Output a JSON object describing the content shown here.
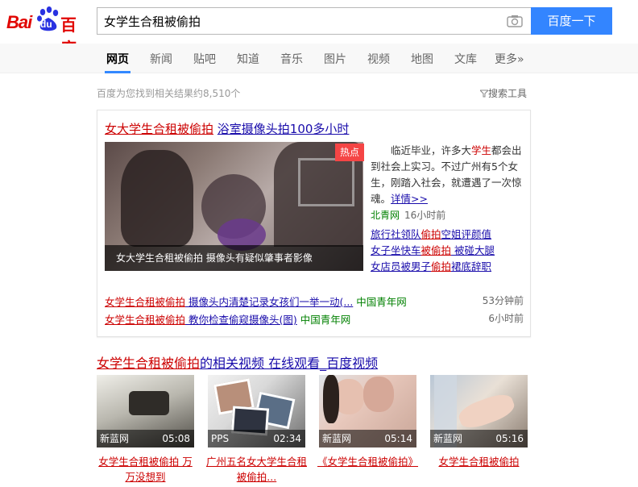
{
  "header": {
    "logo": {
      "latin": "Bai",
      "du": "du",
      "chinese": "百度"
    },
    "search": {
      "value": "女学生合租被偷拍"
    },
    "search_button": "百度一下"
  },
  "tabs": [
    {
      "label": "网页",
      "active": true
    },
    {
      "label": "新闻"
    },
    {
      "label": "贴吧"
    },
    {
      "label": "知道"
    },
    {
      "label": "音乐"
    },
    {
      "label": "图片"
    },
    {
      "label": "视频"
    },
    {
      "label": "地图"
    },
    {
      "label": "文库"
    },
    {
      "label": "更多»"
    }
  ],
  "result_count": "百度为您找到相关结果约8,510个",
  "search_tools": "搜索工具",
  "top_card": {
    "title_hl": "女大学生合租被偷拍",
    "title_rest": "浴室摄像头拍100多小时",
    "hot_badge": "热点",
    "image_caption": "女大学生合租被偷拍 摄像头有疑似肇事者影像",
    "desc_pre": "临近毕业，许多大",
    "desc_hl": "学生",
    "desc_post": "都会出到社会上实习。不过广州有5个女生，刚踏入社会，就遭遇了一次惊魂。",
    "desc_more": "详情>>",
    "source": "北青网",
    "time": "16小时前",
    "side_links": [
      {
        "pre": "旅行社领队",
        "hl": "偷拍",
        "post": "空姐评颜值"
      },
      {
        "pre": "女子坐快车",
        "hl": "被偷拍",
        "post": " 被碰大腿"
      },
      {
        "pre": "女店员被男子",
        "hl": "偷拍",
        "post": "裙底辞职"
      }
    ],
    "sub_results": [
      {
        "hl": "女学生合租被偷拍",
        "rest": " 摄像头内清楚记录女孩们一举一动(...",
        "source": "中国青年网",
        "time": "53分钟前"
      },
      {
        "hl": "女学生合租被偷拍",
        "rest": " 教你检查偷窥摄像头(图)",
        "source": "中国青年网",
        "time": "6小时前"
      }
    ]
  },
  "video_section": {
    "title_hl": "女学生合租被偷拍",
    "title_rest": "的相关视频 在线观看_百度视频",
    "videos": [
      {
        "source": "新蓝网",
        "duration": "05:08",
        "caption": "女学生合租被偷拍 万万没想到"
      },
      {
        "source": "PPS",
        "duration": "02:34",
        "caption": "广州五名女大学生合租被偷拍..."
      },
      {
        "source": "新蓝网",
        "duration": "05:14",
        "caption": "《女学生合租被偷拍》"
      },
      {
        "source": "新蓝网",
        "duration": "05:16",
        "caption": "女学生合租被偷拍"
      }
    ]
  },
  "colors": {
    "brand_red": "#e10602",
    "brand_blue": "#2932e1",
    "button_blue": "#3385ff",
    "link": "#1a0dab",
    "highlight": "#cc0000",
    "source_green": "#008000"
  }
}
